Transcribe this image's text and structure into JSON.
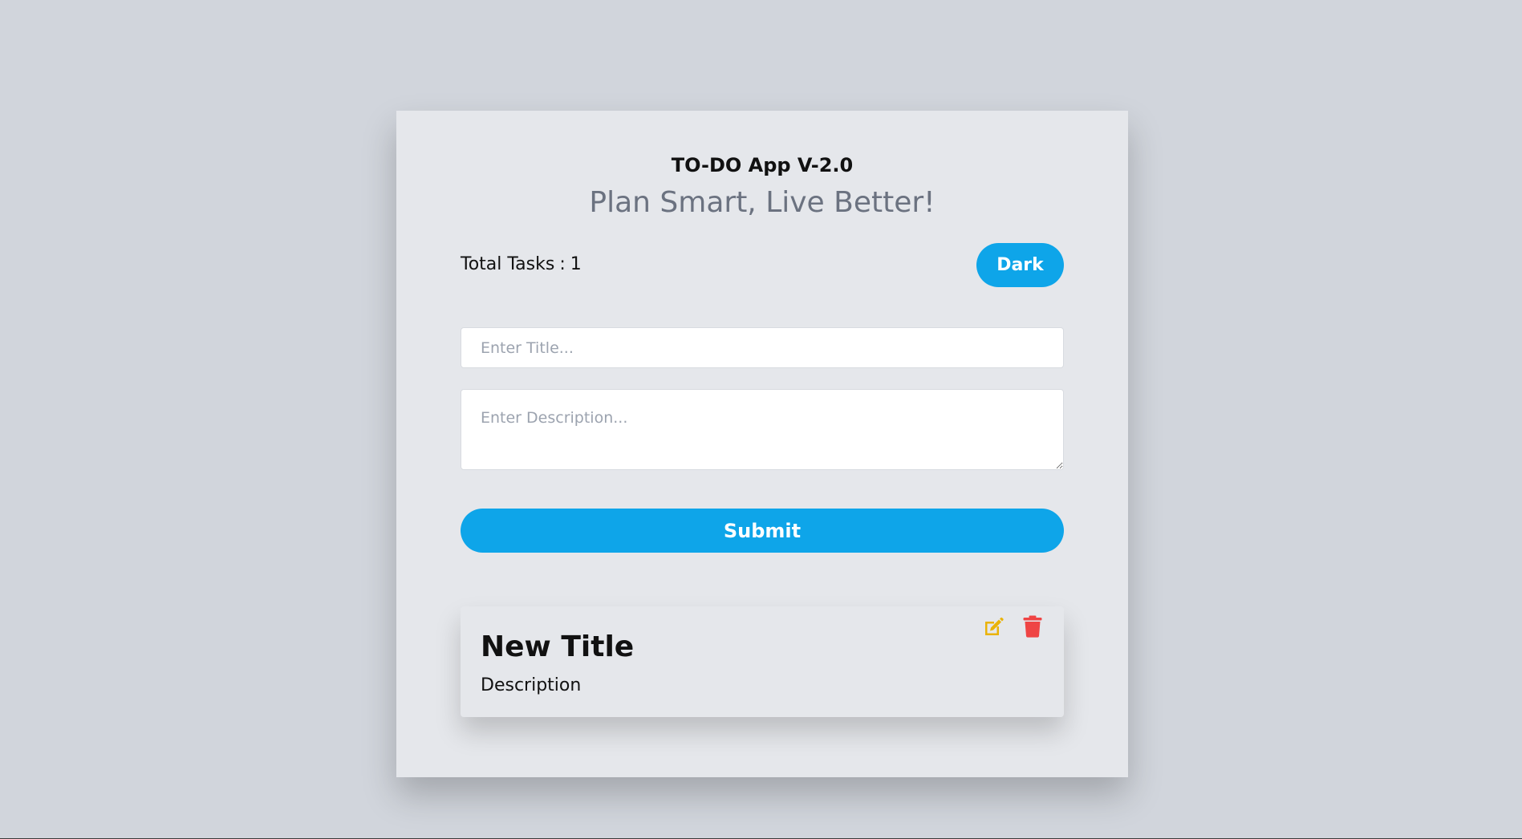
{
  "header": {
    "title": "TO-DO App V-2.0",
    "tagline": "Plan Smart, Live Better!"
  },
  "stats": {
    "total_label": "Total Tasks",
    "separator": ":",
    "total_count": "1"
  },
  "theme_toggle": {
    "label": "Dark"
  },
  "form": {
    "title_placeholder": "Enter Title...",
    "title_value": "",
    "description_placeholder": "Enter Description...",
    "description_value": "",
    "submit_label": "Submit"
  },
  "tasks": [
    {
      "title": "New Title",
      "description": "Description"
    }
  ],
  "icons": {
    "edit": "edit-icon",
    "delete": "trash-icon"
  },
  "colors": {
    "page_background": "#d1d5dc",
    "card_background": "#e5e7eb",
    "accent": "#0ea5e9",
    "edit_icon": "#eab308",
    "delete_icon": "#ef4444",
    "tagline": "#6b7280"
  }
}
